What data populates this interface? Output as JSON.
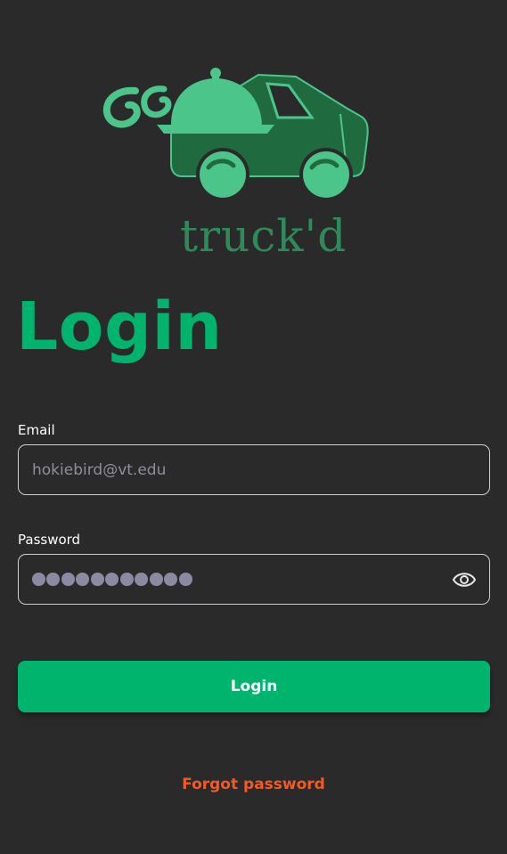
{
  "logo": {
    "wordmark": "truck'd",
    "icon": "food-truck-logo",
    "colors": {
      "dark_green": "#1f6b3f",
      "light_green": "#4cc58a",
      "text_green": "#2f8a5a"
    }
  },
  "title": "Login",
  "email": {
    "label": "Email",
    "placeholder": "hokiebird@vt.edu"
  },
  "password": {
    "label": "Password",
    "masked_length": 11,
    "toggle_icon": "eye-icon"
  },
  "buttons": {
    "login_label": "Login",
    "forgot_label": "Forgot password"
  },
  "colors": {
    "background": "#2a2a2a",
    "accent": "#00b46e",
    "link": "#f15a22",
    "placeholder": "#8e8e9e"
  }
}
